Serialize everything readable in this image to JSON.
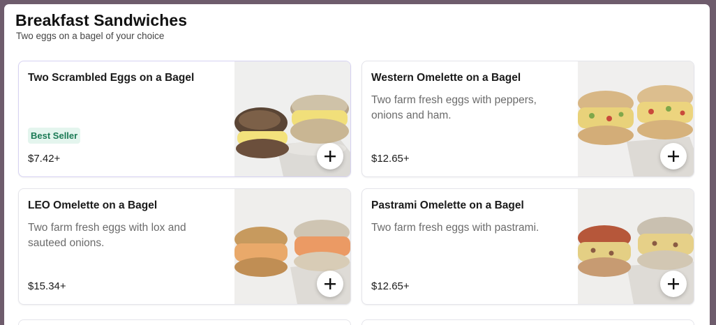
{
  "section": {
    "title": "Breakfast Sandwiches",
    "subtitle": "Two eggs on a bagel of your choice"
  },
  "items": [
    {
      "name": "Two Scrambled Eggs on a Bagel",
      "description": "",
      "badge": "Best Seller",
      "price": "$7.42+",
      "image_icon": "sandwich-photo"
    },
    {
      "name": "Western Omelette on a Bagel",
      "description": "Two farm fresh eggs with peppers, onions and ham.",
      "badge": "",
      "price": "$12.65+",
      "image_icon": "sandwich-photo"
    },
    {
      "name": "LEO Omelette on a Bagel",
      "description": "Two farm fresh eggs with lox and sauteed onions.",
      "badge": "",
      "price": "$15.34+",
      "image_icon": "sandwich-photo"
    },
    {
      "name": "Pastrami Omelette on a Bagel",
      "description": "Two farm fresh eggs with pastrami.",
      "badge": "",
      "price": "$12.65+",
      "image_icon": "sandwich-photo"
    }
  ],
  "colors": {
    "page_background": "#6e5c6c",
    "badge_background": "#e4f5ee",
    "badge_text": "#1b7a55",
    "description_text": "#6b6b6b"
  },
  "icons": {
    "add": "plus-icon"
  }
}
